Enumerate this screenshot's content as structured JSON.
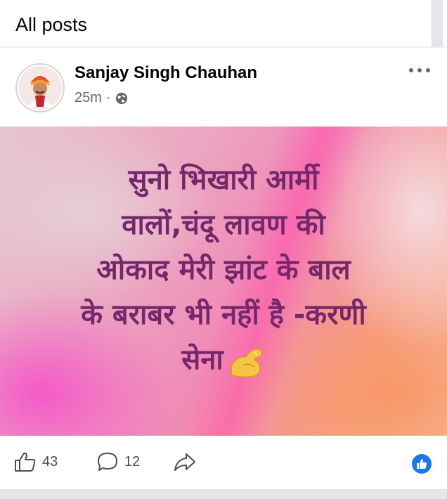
{
  "header": {
    "title": "All posts"
  },
  "post": {
    "author": "Sanjay Singh Chauhan",
    "time": "25m",
    "separator": "·",
    "privacy_icon": "globe-icon",
    "more_icon": "more-options-icon",
    "text_lines": [
      "सुनो भिखारी आर्मी",
      "वालों,चंदू लावण की",
      "ओकाद मेरी झांट के बाल",
      "के बराबर भी नहीं है -करणी",
      "सेना"
    ],
    "emoji": "flexed-biceps-icon",
    "background_colors": [
      "#e6c6cf",
      "#f08ab6",
      "#f7a08a"
    ],
    "text_color": "#74276a"
  },
  "actions": {
    "likes": "43",
    "comments": "12",
    "like_icon": "thumbs-up-icon",
    "comment_icon": "comment-icon",
    "share_icon": "share-icon",
    "reaction_icon": "like-reaction-icon",
    "accent": "#1877f2"
  }
}
